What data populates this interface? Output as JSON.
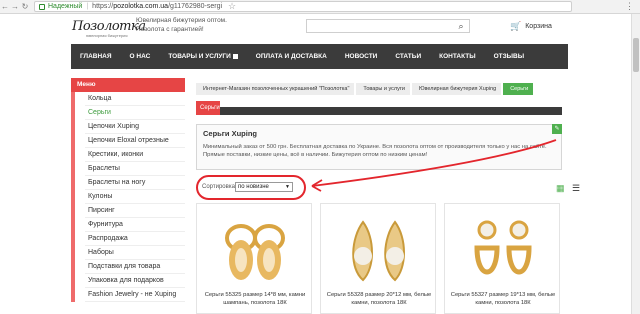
{
  "browser": {
    "secure_label": "Надежный",
    "url_prefix": "https://",
    "url_host": "pozolotka.com.ua",
    "url_path": "/g11762980-sergi"
  },
  "header": {
    "logo_text": "Позолотка",
    "logo_sub": "ювелирная бижутерия",
    "tagline_line1": "Ювелирная бижутерия оптом.",
    "tagline_line2": "Позолота с гарантией!",
    "cart_label": "Корзина"
  },
  "topnav": [
    {
      "label": "ГЛАВНАЯ"
    },
    {
      "label": "О НАС"
    },
    {
      "label": "ТОВАРЫ И УСЛУГИ"
    },
    {
      "label": "ОПЛАТА И ДОСТАВКА"
    },
    {
      "label": "НОВОСТИ"
    },
    {
      "label": "СТАТЬИ"
    },
    {
      "label": "КОНТАКТЫ"
    },
    {
      "label": "ОТЗЫВЫ"
    }
  ],
  "sidebar": {
    "title": "Меню",
    "items": [
      {
        "label": "Кольца"
      },
      {
        "label": "Серьги"
      },
      {
        "label": "Цепочки Xuping"
      },
      {
        "label": "Цепочки Eloxal отрезные"
      },
      {
        "label": "Крестики, иконки"
      },
      {
        "label": "Браслеты"
      },
      {
        "label": "Браслеты на ногу"
      },
      {
        "label": "Кулоны"
      },
      {
        "label": "Пирсинг"
      },
      {
        "label": "Фурнитура"
      },
      {
        "label": "Распродажа"
      },
      {
        "label": "Наборы"
      },
      {
        "label": "Подставки для товара"
      },
      {
        "label": "Упаковка для подарков"
      },
      {
        "label": "Fashion Jewelry - не Xuping"
      }
    ],
    "active_index": 1
  },
  "breadcrumb": [
    {
      "label": "Интернет-Магазин позолоченных украшений \"Позолотка\""
    },
    {
      "label": "Товары и услуги"
    },
    {
      "label": "Ювелирная бижутерия Xuping"
    },
    {
      "label": "Серьги"
    }
  ],
  "section": {
    "tab_label": "Серьги"
  },
  "info": {
    "title": "Серьги Xuping",
    "text": "Минимальный заказ от 500 грн. Бесплатная доставка по Украине. Вся позолота оптом от производителя только у нас на сайте. Прямые поставки, низкие цены, всё в наличии. Бижутерия оптом по низким ценам!"
  },
  "sort": {
    "label": "Сортировка:",
    "value": "по новизне"
  },
  "products": [
    {
      "title": "Серьги 55325 размер 14*8 мм, камни шампань, позолота 18К"
    },
    {
      "title": "Серьги 55328 размер 20*12 мм, белые камни, позолота 18К"
    },
    {
      "title": "Серьги 55327 размер 19*13 мм, белые камни, позолота 18К"
    }
  ],
  "colors": {
    "accent_red": "#e64545",
    "accent_green": "#4fb04f",
    "nav_dark": "#3b3b3b"
  }
}
